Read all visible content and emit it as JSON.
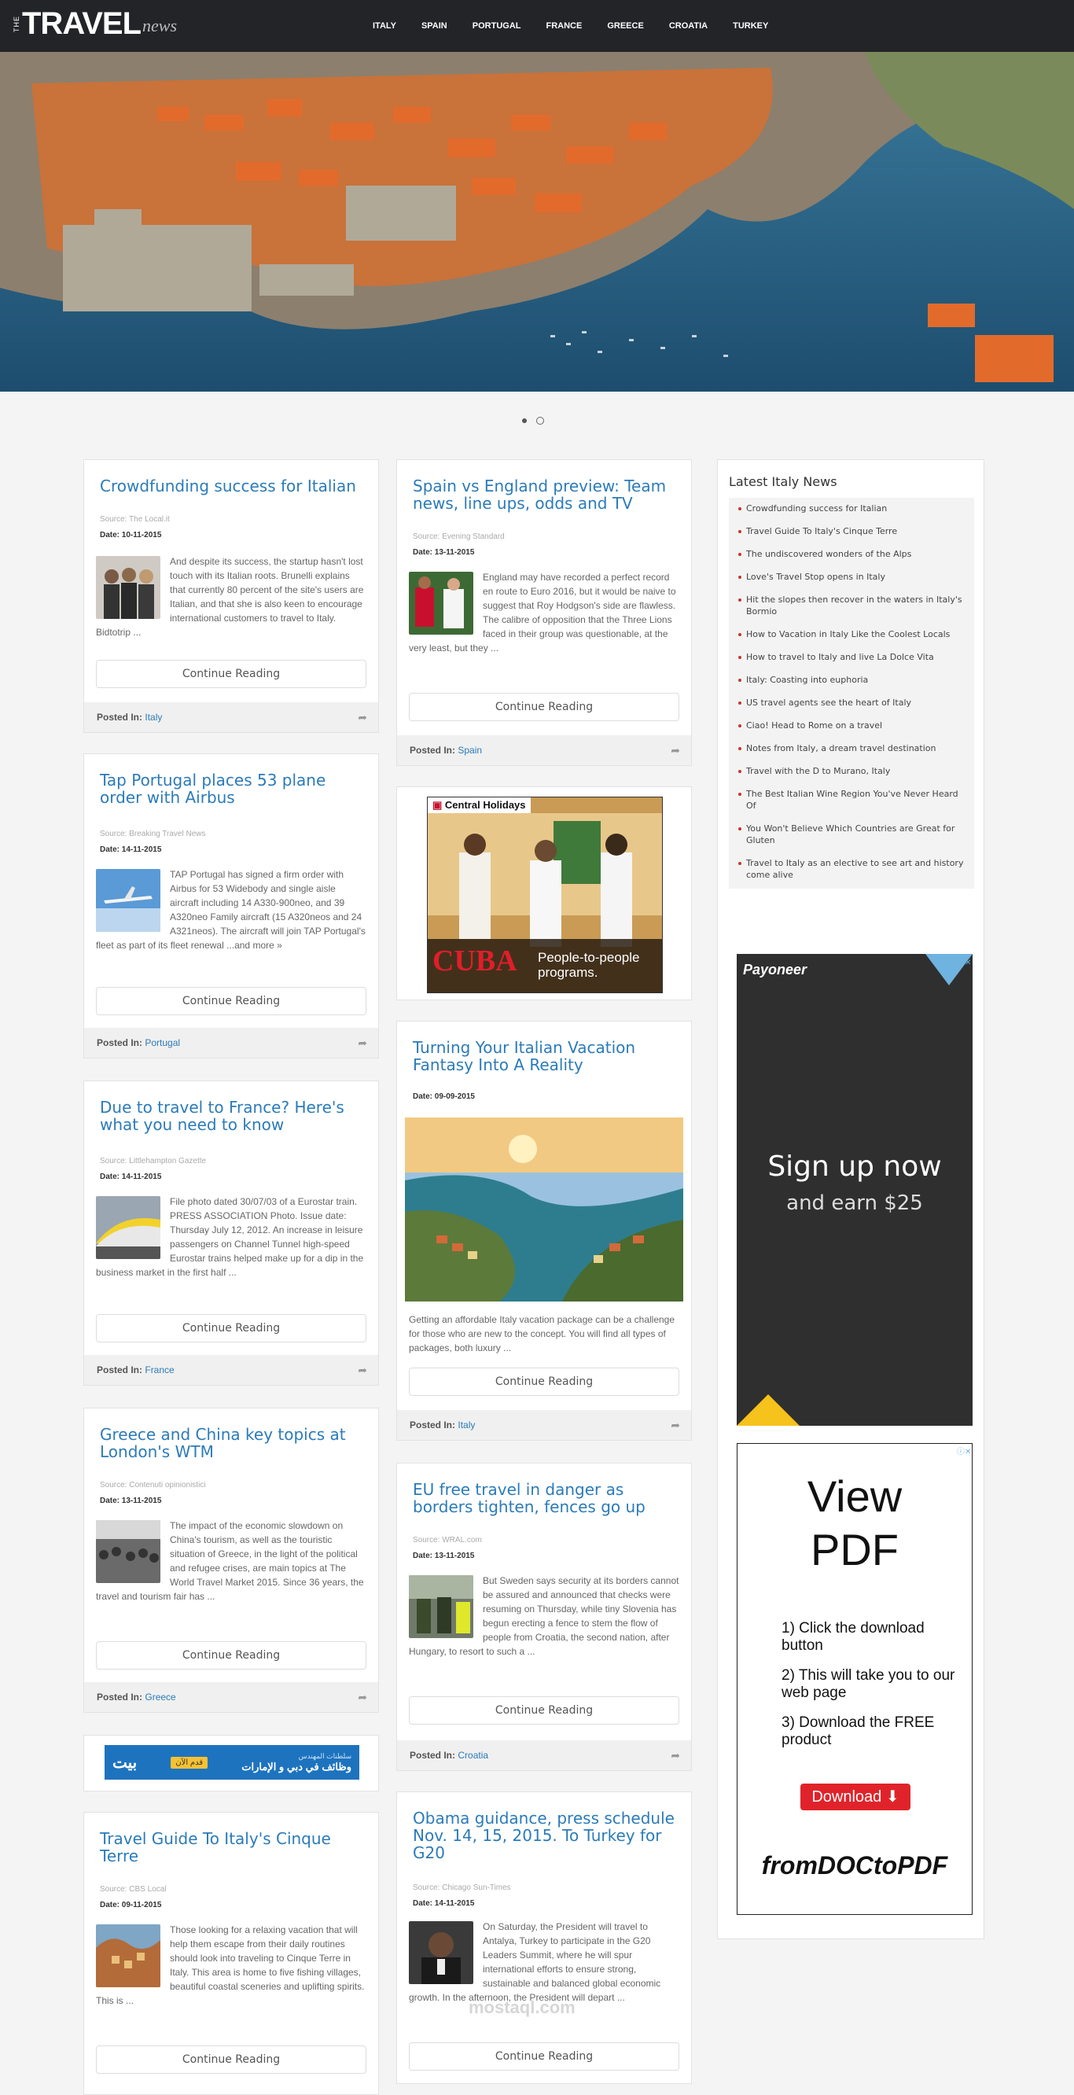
{
  "header": {
    "logo_the": "THE",
    "logo_travel": "TRAVEL",
    "logo_news": "news",
    "nav": [
      "ITALY",
      "SPAIN",
      "PORTUGAL",
      "FRANCE",
      "GREECE",
      "CROATIA",
      "TURKEY"
    ]
  },
  "carousel": {
    "slides": 2,
    "active": 2
  },
  "common": {
    "continue": "Continue Reading",
    "posted_in": "Posted In:"
  },
  "cards": [
    {
      "title": "Crowdfunding success for Italian",
      "source": "Source: The Local.it",
      "date": "Date: 10-11-2015",
      "excerpt": "And despite its success, the startup hasn't lost touch with its Italian roots. Brunelli explains that currently 80 percent of the site's users are Italian, and that she is also keen to encourage international customers to travel to Italy. Bidtotrip ...",
      "category": "Italy"
    },
    {
      "title": "Tap Portugal places 53 plane order with Airbus",
      "source": "Source: Breaking Travel News",
      "date": "Date: 14-11-2015",
      "excerpt": "TAP Portugal has signed a firm order with Airbus for 53 Widebody and single aisle aircraft including 14 A330-900neo, and 39 A320neo Family aircraft (15 A320neos and 24 A321neos). The aircraft will join TAP Portugal's fleet as part of its fleet renewal ...and more »",
      "category": "Portugal"
    },
    {
      "title": "Due to travel to France? Here's what you need to know",
      "source": "Source: Littlehampton Gazette",
      "date": "Date: 14-11-2015",
      "excerpt": "File photo dated 30/07/03 of a Eurostar train. PRESS ASSOCIATION Photo. Issue date: Thursday July 12, 2012. An increase in leisure passengers on Channel Tunnel high-speed Eurostar trains helped make up for a dip in the business market in the first half ...",
      "category": "France"
    },
    {
      "title": "Greece and China key topics at London's WTM",
      "source": "Source: Contenuti opinionistici",
      "date": "Date: 13-11-2015",
      "excerpt": "The impact of the economic slowdown on China's tourism, as well as the touristic situation of Greece, in the light of the political and refugee crises, are main topics at The World Travel Market 2015. Since 36 years, the travel and tourism fair has ...",
      "category": "Greece"
    },
    {
      "title": "Travel Guide To Italy's Cinque Terre",
      "source": "Source: CBS Local",
      "date": "Date: 09-11-2015",
      "excerpt": "Those looking for a relaxing vacation that will help them escape from their daily routines should look into traveling to Cinque Terre in Italy. This area is home to five fishing villages, beautiful coastal sceneries and uplifting spirits. This is ...",
      "category": ""
    },
    {
      "title": "Spain vs England preview: Team news, line ups, odds and TV",
      "source": "Source: Evening Standard",
      "date": "Date: 13-11-2015",
      "excerpt": "England may have recorded a perfect record en route to Euro 2016, but it would be naive to suggest that Roy Hodgson's side are flawless. The calibre of opposition that the Three Lions faced in their group was questionable, at the very least, but they ...",
      "category": "Spain"
    },
    {
      "title": "Turning Your Italian Vacation Fantasy Into A Reality",
      "date": "Date: 09-09-2015",
      "excerpt": "Getting an affordable Italy vacation package can be a challenge for those who are new to the concept. You will find all types of packages, both luxury ...",
      "category": "Italy"
    },
    {
      "title": "EU free travel in danger as borders tighten, fences go up",
      "source": "Source: WRAL.com",
      "date": "Date: 13-11-2015",
      "excerpt": "But Sweden says security at its borders cannot be assured and announced that checks were resuming on Thursday, while tiny Slovenia has begun erecting a fence to stem the flow of people from Croatia, the second nation, after Hungary, to resort to such a ...",
      "category": "Croatia"
    },
    {
      "title": "Obama guidance, press schedule Nov. 14, 15, 2015. To Turkey for G20",
      "source": "Source: Chicago Sun-Times",
      "date": "Date: 14-11-2015",
      "excerpt": "On Saturday, the President will travel to Antalya, Turkey to participate in the G20 Leaders Summit, where he will spur international efforts to ensure strong, sustainable and balanced global economic growth. In the afternoon, the President will depart ..."
    }
  ],
  "ads": {
    "central_brand": "Central Holidays",
    "central_cuba": "CUBA",
    "central_tag1": "People-to-people",
    "central_tag2": "programs.",
    "bayt_logo": "بيت",
    "bayt_top": "سلطنات المهندس",
    "bayt_main": "وظائف في دبي و الإمارات",
    "bayt_cta": "قدم الآن",
    "payoneer_brand": "Payoneer",
    "payoneer_line1": "Sign up now",
    "payoneer_line2": "and earn $25",
    "pdf_title1": "View",
    "pdf_title2": "PDF",
    "pdf_steps": [
      "1) Click the download button",
      "2) This will take you to our web page",
      "3) Download the FREE product"
    ],
    "pdf_button": "Download",
    "pdf_brand": "fromDOCtoPDF"
  },
  "sidebar": {
    "title": "Latest Italy News",
    "items": [
      "Crowdfunding success for Italian",
      "Travel Guide To Italy's Cinque Terre",
      "The undiscovered wonders of the Alps",
      "Love's Travel Stop opens in Italy",
      "Hit the slopes then recover in the waters in Italy's Bormio",
      "How to Vacation in Italy Like the Coolest Locals",
      "How to travel to Italy and live La Dolce Vita",
      "Italy: Coasting into euphoria",
      "US travel agents see the heart of Italy",
      "Ciao! Head to Rome on a travel",
      "Notes from Italy, a dream travel destination",
      "Travel with the D to Murano, Italy",
      "The Best Italian Wine Region You've Never Heard Of",
      "You Won't Believe Which Countries are Great for Gluten",
      "Travel to Italy as an elective to see art and history come alive"
    ]
  },
  "watermark": "mostaql.com"
}
